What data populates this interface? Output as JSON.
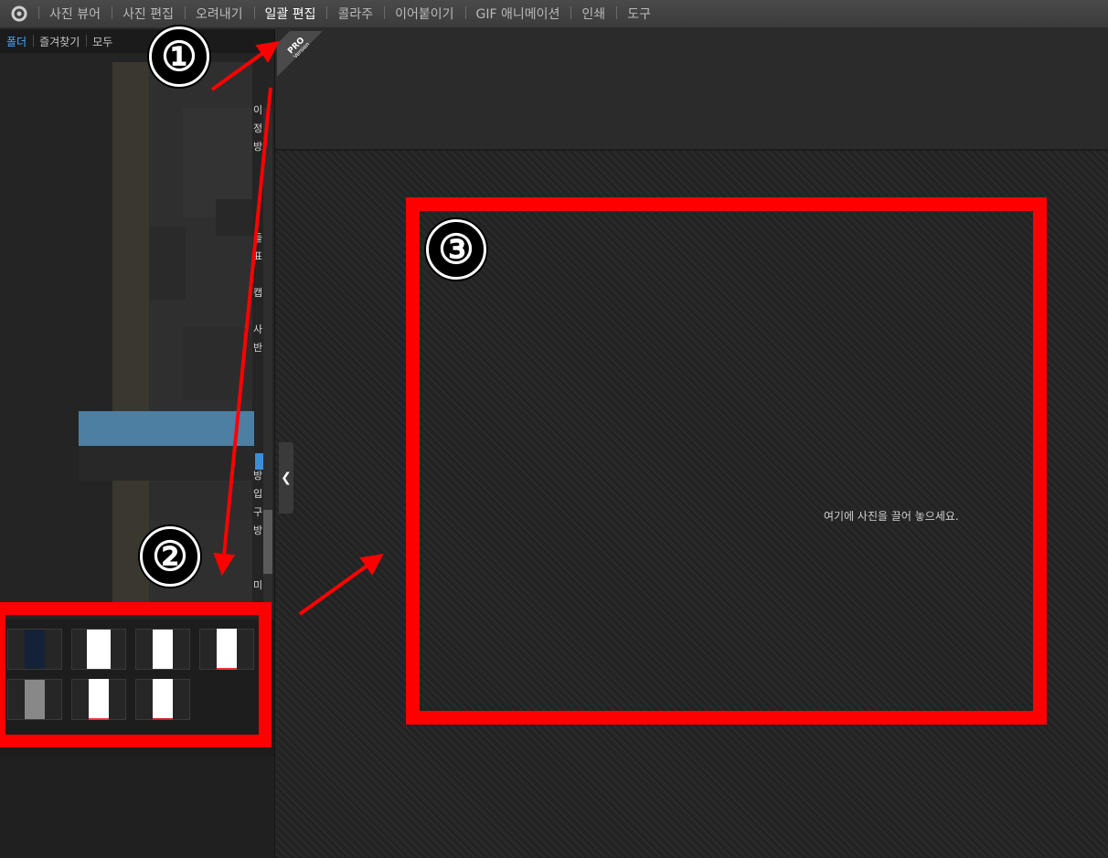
{
  "menu": {
    "items": [
      "사진 뷰어",
      "사진 편집",
      "오려내기",
      "일괄 편집",
      "콜라주",
      "이어붙이기",
      "GIF 애니메이션",
      "인쇄",
      "도구"
    ],
    "active_index": 3
  },
  "left_panel": {
    "tabs": [
      "폴더",
      "즐겨찾기",
      "모두"
    ],
    "active_tab": 0,
    "side_texts": [
      "이",
      "정",
      "방",
      "들",
      "표",
      "캡",
      "사",
      "반",
      "방",
      "입",
      "구",
      "방",
      "미"
    ],
    "thumbnail_count": 7
  },
  "badge": {
    "line1": "PRO",
    "line2": "Version"
  },
  "canvas": {
    "drop_hint": "여기에 사진을 끌어 놓으세요."
  },
  "annotations": {
    "markers": [
      "①",
      "②",
      "③"
    ],
    "color": "#ff0000"
  },
  "colors": {
    "accent": "#4aa8ff",
    "annotation": "#ff0000"
  }
}
